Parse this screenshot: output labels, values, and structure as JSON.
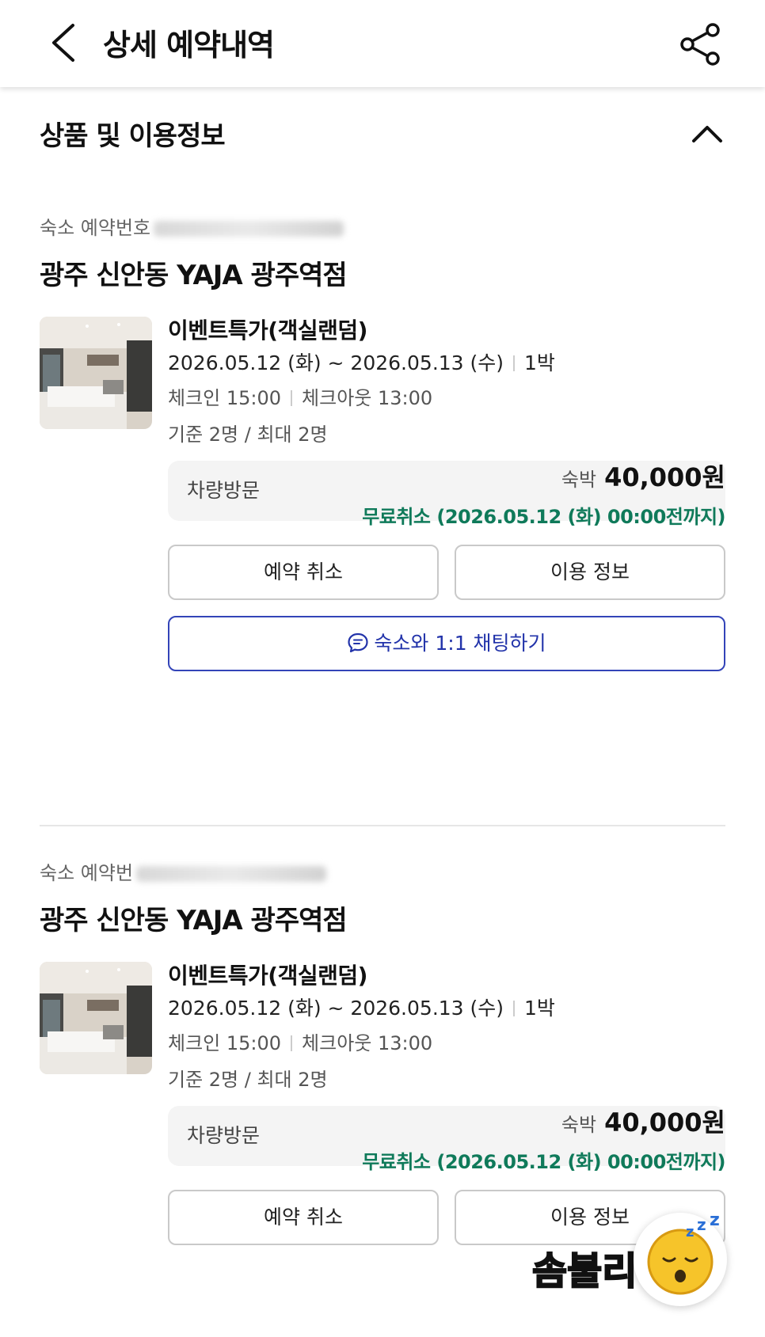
{
  "header": {
    "title": "상세 예약내역",
    "back_icon": "chevron-left-icon",
    "share_icon": "share-icon"
  },
  "section": {
    "title": "상품 및 이용정보",
    "collapse_icon": "chevron-up-icon"
  },
  "bookings": [
    {
      "reservation_label": "숙소 예약번호",
      "hotel_name": "광주 신안동 YAJA 광주역점",
      "room_name": "이벤트특가(객실랜덤)",
      "date_range": "2026.05.12 (화) ~ 2026.05.13 (수)",
      "nights": "1박",
      "check_in": "체크인 15:00",
      "check_out": "체크아웃 13:00",
      "capacity": "기준 2명 / 최대 2명",
      "memo": "차량방문",
      "price_label": "숙박",
      "price": "40,000원",
      "cancel_policy": "무료취소 (2026.05.12 (화) 00:00전까지)",
      "cancel_button": "예약 취소",
      "info_button": "이용 정보",
      "chat_button": "숙소와 1:1 채팅하기"
    },
    {
      "reservation_label": "숙소 예약번",
      "hotel_name": "광주 신안동 YAJA 광주역점",
      "room_name": "이벤트특가(객실랜덤)",
      "date_range": "2026.05.12 (화) ~ 2026.05.13 (수)",
      "nights": "1박",
      "check_in": "체크인 15:00",
      "check_out": "체크아웃 13:00",
      "capacity": "기준 2명 / 최대 2명",
      "memo": "차량방문",
      "price_label": "숙박",
      "price": "40,000원",
      "cancel_policy": "무료취소 (2026.05.12 (화) 00:00전까지)",
      "cancel_button": "예약 취소",
      "info_button": "이용 정보"
    }
  ],
  "sticker": {
    "text": "솜불리",
    "icon": "sleeping-face-icon"
  },
  "colors": {
    "accent_green": "#0f7a5a",
    "chat_blue": "#2233aa",
    "memo_bg": "#f4f4f4"
  }
}
